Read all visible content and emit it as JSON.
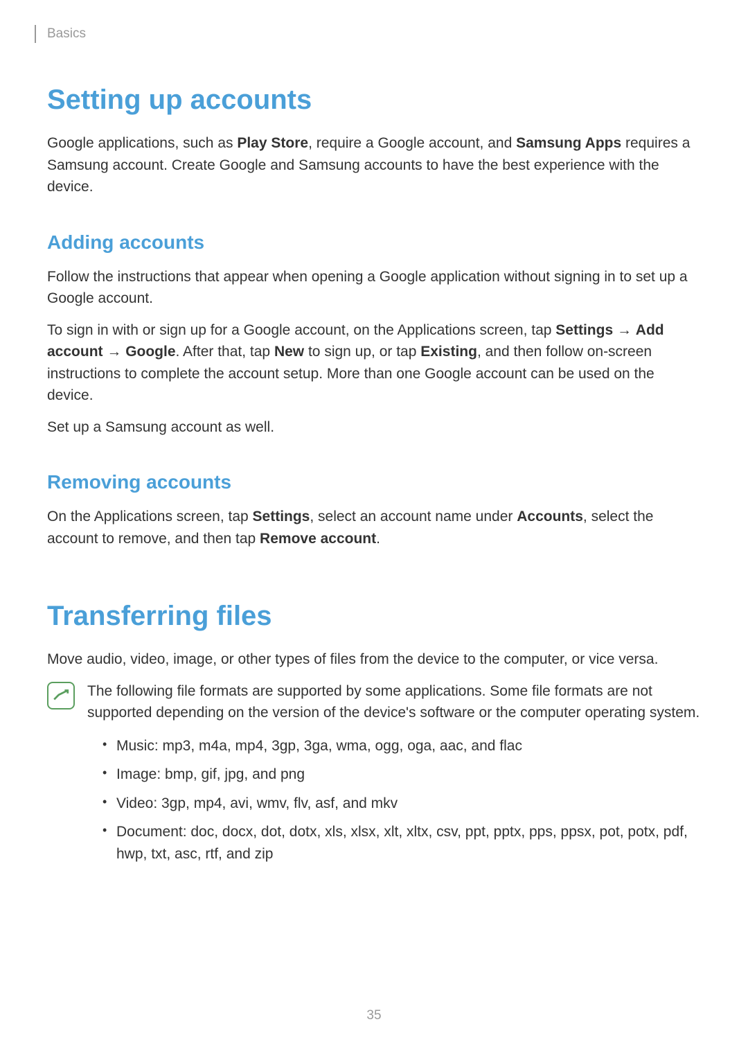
{
  "header": {
    "breadcrumb": "Basics"
  },
  "section1": {
    "title": "Setting up accounts",
    "intro_p1_a": "Google applications, such as ",
    "intro_p1_b": "Play Store",
    "intro_p1_c": ", require a Google account, and ",
    "intro_p1_d": "Samsung Apps",
    "intro_p1_e": " requires a Samsung account. Create Google and Samsung accounts to have the best experience with the device.",
    "sub1": {
      "title": "Adding accounts",
      "p1": "Follow the instructions that appear when opening a Google application without signing in to set up a Google account.",
      "p2_a": "To sign in with or sign up for a Google account, on the Applications screen, tap ",
      "p2_b": "Settings",
      "p2_c": " → ",
      "p2_d": "Add account",
      "p2_e": " → ",
      "p2_f": "Google",
      "p2_g": ". After that, tap ",
      "p2_h": "New",
      "p2_i": " to sign up, or tap ",
      "p2_j": "Existing",
      "p2_k": ", and then follow on-screen instructions to complete the account setup. More than one Google account can be used on the device.",
      "p3": "Set up a Samsung account as well."
    },
    "sub2": {
      "title": "Removing accounts",
      "p1_a": "On the Applications screen, tap ",
      "p1_b": "Settings",
      "p1_c": ", select an account name under ",
      "p1_d": "Accounts",
      "p1_e": ", select the account to remove, and then tap ",
      "p1_f": "Remove account",
      "p1_g": "."
    }
  },
  "section2": {
    "title": "Transferring files",
    "p1": "Move audio, video, image, or other types of files from the device to the computer, or vice versa.",
    "note": {
      "p1": "The following file formats are supported by some applications. Some file formats are not supported depending on the version of the device's software or the computer operating system.",
      "items": [
        "Music: mp3, m4a, mp4, 3gp, 3ga, wma, ogg, oga, aac, and flac",
        "Image: bmp, gif, jpg, and png",
        "Video: 3gp, mp4, avi, wmv, flv, asf, and mkv",
        "Document: doc, docx, dot, dotx, xls, xlsx, xlt, xltx, csv, ppt, pptx, pps, ppsx, pot, potx, pdf, hwp, txt, asc, rtf, and zip"
      ]
    }
  },
  "page_number": "35"
}
